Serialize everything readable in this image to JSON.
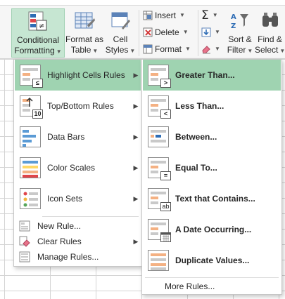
{
  "ribbon": {
    "conditional_formatting": "Conditional\nFormatting",
    "conditional_formatting_line1": "Conditional",
    "conditional_formatting_line2": "Formatting",
    "format_as_table_line1": "Format as",
    "format_as_table_line2": "Table",
    "cell_styles_line1": "Cell",
    "cell_styles_line2": "Styles",
    "insert": "Insert",
    "delete": "Delete",
    "format": "Format",
    "sort_filter_line1": "Sort &",
    "sort_filter_line2": "Filter",
    "find_select_line1": "Find &",
    "find_select_line2": "Select"
  },
  "menu_main": {
    "items": [
      {
        "label": "Highlight Cells Rules",
        "icon": "highlight-cells-icon"
      },
      {
        "label": "Top/Bottom Rules",
        "icon": "top-bottom-icon"
      },
      {
        "label": "Data Bars",
        "icon": "data-bars-icon"
      },
      {
        "label": "Color Scales",
        "icon": "color-scales-icon"
      },
      {
        "label": "Icon Sets",
        "icon": "icon-sets-icon"
      },
      {
        "label": "New Rule...",
        "icon": "new-rule-icon"
      },
      {
        "label": "Clear Rules",
        "icon": "clear-rules-icon"
      },
      {
        "label": "Manage Rules...",
        "icon": "manage-rules-icon"
      }
    ]
  },
  "menu_sub": {
    "items": [
      {
        "label": "Greater Than...",
        "badge": ">"
      },
      {
        "label": "Less Than...",
        "badge": "<"
      },
      {
        "label": "Between...",
        "badge": ""
      },
      {
        "label": "Equal To...",
        "badge": "="
      },
      {
        "label": "Text that Contains...",
        "badge": "ab"
      },
      {
        "label": "A Date Occurring...",
        "badge": ""
      },
      {
        "label": "Duplicate Values...",
        "badge": ""
      }
    ],
    "more_rules": "More Rules..."
  },
  "colors": {
    "highlight": "#9fd3b1",
    "ribbon_active": "#c6e6d2",
    "accent_orange": "#f4b183"
  }
}
